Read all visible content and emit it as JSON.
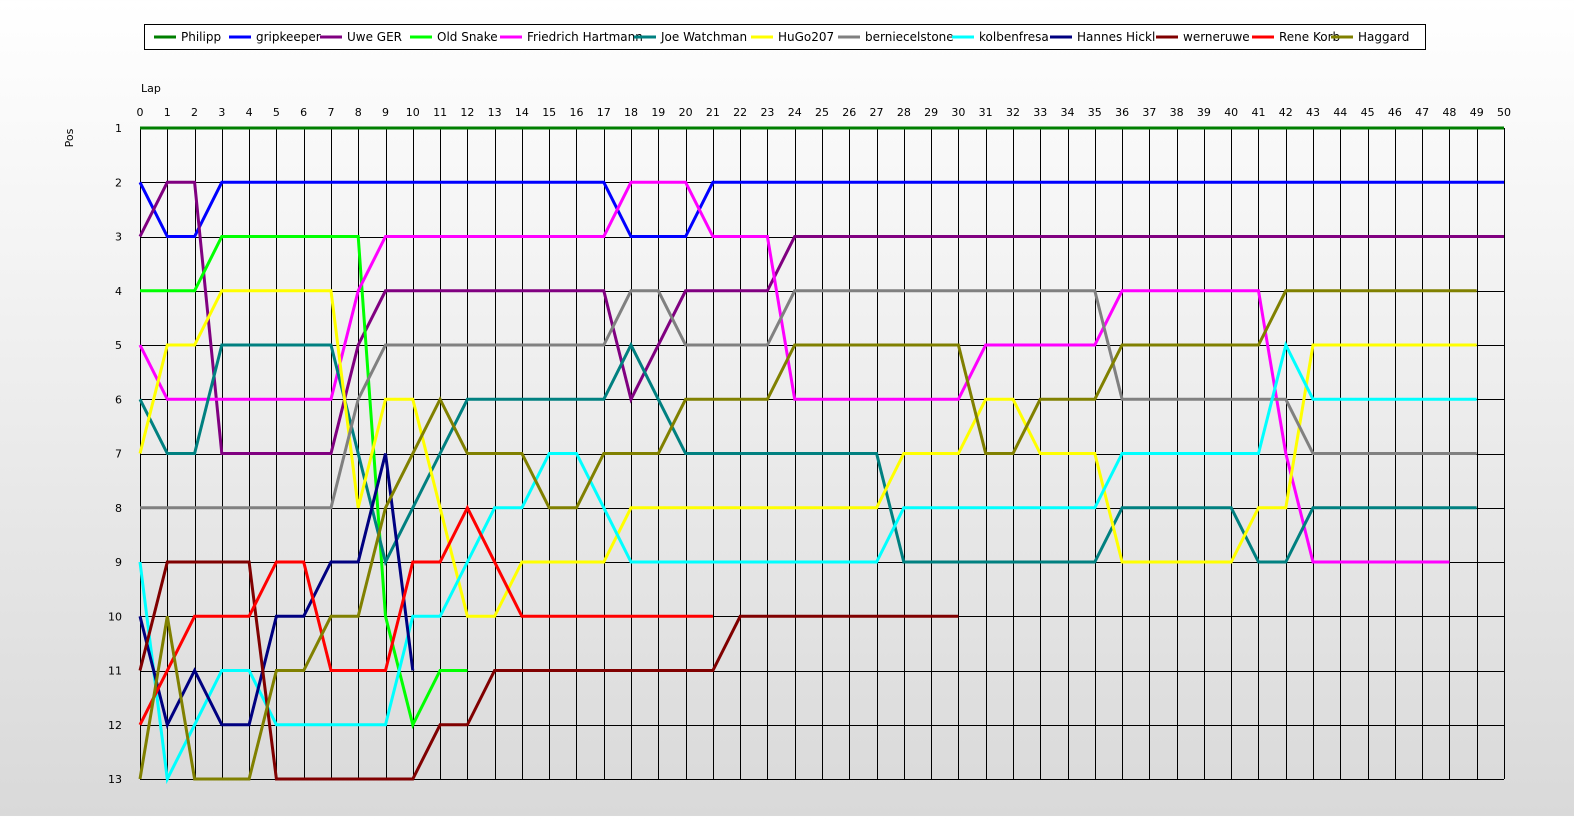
{
  "chart_data": {
    "type": "line",
    "xlabel": "Lap",
    "ylabel": "Pos",
    "xlim": [
      0,
      50
    ],
    "ylim": [
      1,
      13
    ],
    "y_inverted": true,
    "grid": true,
    "legend_position": "top",
    "x_ticks": [
      0,
      1,
      2,
      3,
      4,
      5,
      6,
      7,
      8,
      9,
      10,
      11,
      12,
      13,
      14,
      15,
      16,
      17,
      18,
      19,
      20,
      21,
      22,
      23,
      24,
      25,
      26,
      27,
      28,
      29,
      30,
      31,
      32,
      33,
      34,
      35,
      36,
      37,
      38,
      39,
      40,
      41,
      42,
      43,
      44,
      45,
      46,
      47,
      48,
      49,
      50
    ],
    "y_ticks": [
      1,
      2,
      3,
      4,
      5,
      6,
      7,
      8,
      9,
      10,
      11,
      12,
      13
    ],
    "series": [
      {
        "name": "Philipp",
        "color": "#007f00",
        "points": [
          [
            0,
            1
          ],
          [
            50,
            1
          ]
        ]
      },
      {
        "name": "gripkeeper",
        "color": "#0000ff",
        "points": [
          [
            0,
            2
          ],
          [
            1,
            3
          ],
          [
            2,
            3
          ],
          [
            3,
            2
          ],
          [
            17,
            2
          ],
          [
            18,
            3
          ],
          [
            20,
            3
          ],
          [
            21,
            2
          ],
          [
            50,
            2
          ]
        ]
      },
      {
        "name": "Uwe GER",
        "color": "#800080",
        "points": [
          [
            0,
            3
          ],
          [
            1,
            2
          ],
          [
            2,
            2
          ],
          [
            3,
            7
          ],
          [
            7,
            7
          ],
          [
            8,
            5
          ],
          [
            9,
            4
          ],
          [
            17,
            4
          ],
          [
            18,
            6
          ],
          [
            20,
            4
          ],
          [
            23,
            4
          ],
          [
            24,
            3
          ],
          [
            50,
            3
          ]
        ]
      },
      {
        "name": "Old Snake",
        "color": "#00ff00",
        "points": [
          [
            0,
            4
          ],
          [
            2,
            4
          ],
          [
            3,
            3
          ],
          [
            8,
            3
          ],
          [
            9,
            10
          ],
          [
            10,
            12
          ],
          [
            11,
            11
          ],
          [
            12,
            11
          ]
        ]
      },
      {
        "name": "Friedrich Hartmann",
        "color": "#ff00ff",
        "points": [
          [
            0,
            5
          ],
          [
            1,
            6
          ],
          [
            7,
            6
          ],
          [
            8,
            4
          ],
          [
            9,
            3
          ],
          [
            17,
            3
          ],
          [
            18,
            2
          ],
          [
            20,
            2
          ],
          [
            21,
            3
          ],
          [
            23,
            3
          ],
          [
            24,
            6
          ],
          [
            30,
            6
          ],
          [
            31,
            5
          ],
          [
            35,
            5
          ],
          [
            36,
            4
          ],
          [
            41,
            4
          ],
          [
            42,
            7
          ],
          [
            43,
            9
          ],
          [
            48,
            9
          ]
        ]
      },
      {
        "name": "Joe Watchman",
        "color": "#008080",
        "points": [
          [
            0,
            6
          ],
          [
            1,
            7
          ],
          [
            2,
            7
          ],
          [
            3,
            5
          ],
          [
            7,
            5
          ],
          [
            8,
            7
          ],
          [
            9,
            9
          ],
          [
            10,
            8
          ],
          [
            11,
            7
          ],
          [
            12,
            6
          ],
          [
            17,
            6
          ],
          [
            18,
            5
          ],
          [
            19,
            6
          ],
          [
            20,
            7
          ],
          [
            27,
            7
          ],
          [
            28,
            9
          ],
          [
            35,
            9
          ],
          [
            36,
            8
          ],
          [
            40,
            8
          ],
          [
            41,
            9
          ],
          [
            42,
            9
          ],
          [
            43,
            8
          ],
          [
            49,
            8
          ]
        ]
      },
      {
        "name": "HuGo207",
        "color": "#ffff00",
        "points": [
          [
            0,
            7
          ],
          [
            1,
            5
          ],
          [
            2,
            5
          ],
          [
            3,
            4
          ],
          [
            7,
            4
          ],
          [
            8,
            8
          ],
          [
            9,
            6
          ],
          [
            10,
            6
          ],
          [
            11,
            8
          ],
          [
            12,
            10
          ],
          [
            13,
            10
          ],
          [
            14,
            9
          ],
          [
            17,
            9
          ],
          [
            18,
            8
          ],
          [
            27,
            8
          ],
          [
            28,
            7
          ],
          [
            30,
            7
          ],
          [
            31,
            6
          ],
          [
            32,
            6
          ],
          [
            33,
            7
          ],
          [
            35,
            7
          ],
          [
            36,
            9
          ],
          [
            40,
            9
          ],
          [
            41,
            8
          ],
          [
            42,
            8
          ],
          [
            43,
            5
          ],
          [
            49,
            5
          ]
        ]
      },
      {
        "name": "berniecelstone",
        "color": "#808080",
        "points": [
          [
            0,
            8
          ],
          [
            7,
            8
          ],
          [
            8,
            6
          ],
          [
            9,
            5
          ],
          [
            17,
            5
          ],
          [
            18,
            4
          ],
          [
            19,
            4
          ],
          [
            20,
            5
          ],
          [
            23,
            5
          ],
          [
            24,
            4
          ],
          [
            35,
            4
          ],
          [
            36,
            6
          ],
          [
            41,
            6
          ],
          [
            42,
            6
          ],
          [
            43,
            7
          ],
          [
            49,
            7
          ]
        ]
      },
      {
        "name": "kolbenfresa",
        "color": "#00ffff",
        "points": [
          [
            0,
            9
          ],
          [
            1,
            13
          ],
          [
            2,
            12
          ],
          [
            3,
            11
          ],
          [
            4,
            11
          ],
          [
            5,
            12
          ],
          [
            9,
            12
          ],
          [
            10,
            10
          ],
          [
            11,
            10
          ],
          [
            12,
            9
          ],
          [
            13,
            8
          ],
          [
            14,
            8
          ],
          [
            15,
            7
          ],
          [
            16,
            7
          ],
          [
            17,
            8
          ],
          [
            18,
            9
          ],
          [
            27,
            9
          ],
          [
            28,
            8
          ],
          [
            35,
            8
          ],
          [
            36,
            7
          ],
          [
            41,
            7
          ],
          [
            42,
            5
          ],
          [
            43,
            6
          ],
          [
            49,
            6
          ]
        ]
      },
      {
        "name": "Hannes Hickl",
        "color": "#000080",
        "points": [
          [
            0,
            10
          ],
          [
            1,
            12
          ],
          [
            2,
            11
          ],
          [
            3,
            12
          ],
          [
            4,
            12
          ],
          [
            5,
            10
          ],
          [
            6,
            10
          ],
          [
            7,
            9
          ],
          [
            8,
            9
          ],
          [
            9,
            7
          ],
          [
            10,
            11
          ]
        ]
      },
      {
        "name": "werneruwe",
        "color": "#800000",
        "points": [
          [
            0,
            11
          ],
          [
            1,
            9
          ],
          [
            4,
            9
          ],
          [
            5,
            13
          ],
          [
            10,
            13
          ],
          [
            11,
            12
          ],
          [
            12,
            12
          ],
          [
            13,
            11
          ],
          [
            21,
            11
          ],
          [
            22,
            10
          ],
          [
            30,
            10
          ]
        ]
      },
      {
        "name": "Rene Korb",
        "color": "#ff0000",
        "points": [
          [
            0,
            12
          ],
          [
            2,
            10
          ],
          [
            4,
            10
          ],
          [
            5,
            9
          ],
          [
            6,
            9
          ],
          [
            7,
            11
          ],
          [
            9,
            11
          ],
          [
            10,
            9
          ],
          [
            11,
            9
          ],
          [
            12,
            8
          ],
          [
            14,
            10
          ],
          [
            21,
            10
          ]
        ]
      },
      {
        "name": "Haggard",
        "color": "#808000",
        "points": [
          [
            0,
            13
          ],
          [
            1,
            10
          ],
          [
            2,
            13
          ],
          [
            4,
            13
          ],
          [
            5,
            11
          ],
          [
            6,
            11
          ],
          [
            7,
            10
          ],
          [
            8,
            10
          ],
          [
            9,
            8
          ],
          [
            11,
            6
          ],
          [
            12,
            7
          ],
          [
            14,
            7
          ],
          [
            15,
            8
          ],
          [
            16,
            8
          ],
          [
            17,
            7
          ],
          [
            19,
            7
          ],
          [
            20,
            6
          ],
          [
            23,
            6
          ],
          [
            24,
            5
          ],
          [
            30,
            5
          ],
          [
            31,
            7
          ],
          [
            32,
            7
          ],
          [
            33,
            6
          ],
          [
            35,
            6
          ],
          [
            36,
            5
          ],
          [
            41,
            5
          ],
          [
            42,
            4
          ],
          [
            49,
            4
          ]
        ]
      }
    ]
  }
}
